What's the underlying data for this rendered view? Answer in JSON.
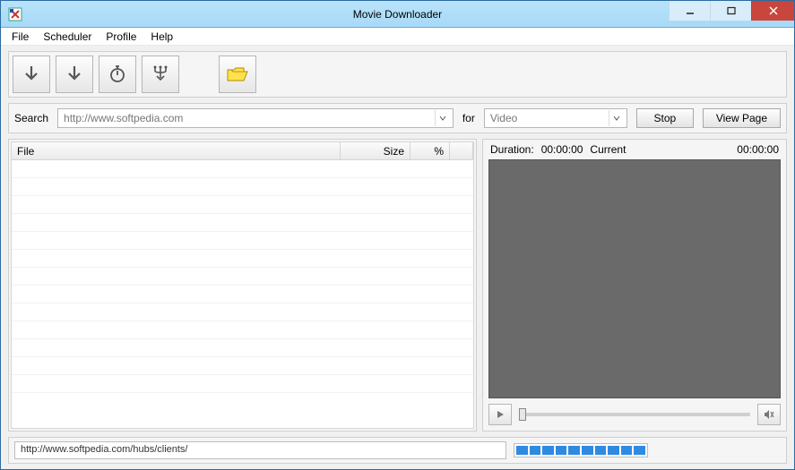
{
  "window": {
    "title": "Movie Downloader"
  },
  "menu": {
    "items": [
      "File",
      "Scheduler",
      "Profile",
      "Help"
    ]
  },
  "toolbar": {
    "buttons": [
      {
        "name": "download-arrow-1-icon"
      },
      {
        "name": "download-arrow-2-icon"
      },
      {
        "name": "stopwatch-icon"
      },
      {
        "name": "download-tree-icon"
      },
      {
        "name": "folder-open-icon"
      }
    ]
  },
  "search": {
    "label": "Search",
    "url": "http://www.softpedia.com",
    "for_label": "for",
    "type": "Video",
    "stop_label": "Stop",
    "view_page_label": "View Page"
  },
  "table": {
    "columns": {
      "file": "File",
      "size": "Size",
      "pct": "%"
    },
    "rows": []
  },
  "preview": {
    "duration_label": "Duration:",
    "duration_value": "00:00:00",
    "current_label": "Current",
    "current_value": "00:00:00"
  },
  "status": {
    "url": "http://www.softpedia.com/hubs/clients/",
    "progress_segments": 10
  }
}
